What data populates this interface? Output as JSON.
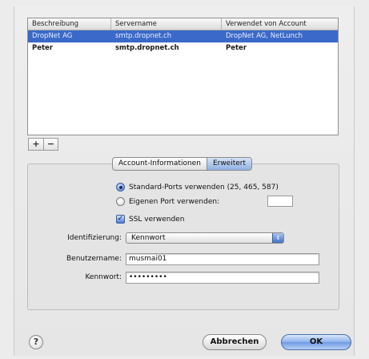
{
  "table": {
    "columns": [
      "Beschreibung",
      "Servername",
      "Verwendet von Account"
    ],
    "rows": [
      {
        "description": "DropNet AG",
        "server": "smtp.dropnet.ch",
        "used_by": "DropNet AG, NetLunch",
        "selected": true
      },
      {
        "description": "Peter",
        "server": "smtp.dropnet.ch",
        "used_by": "Peter",
        "selected": false
      }
    ]
  },
  "list_controls": {
    "add": "+",
    "remove": "−"
  },
  "tabs": [
    {
      "label": "Account-Informationen",
      "active": false
    },
    {
      "label": "Erweitert",
      "active": true
    }
  ],
  "ports": {
    "standard_label": "Standard-Ports verwenden (25, 465, 587)",
    "custom_label": "Eigenen Port verwenden:",
    "custom_value": ""
  },
  "ssl": {
    "label": "SSL verwenden",
    "checked": true,
    "check_glyph": "✓"
  },
  "auth": {
    "label": "Identifizierung:",
    "value": "Kennwort",
    "arrows": "⇕"
  },
  "username": {
    "label": "Benutzername:",
    "value": "musmai01"
  },
  "password": {
    "label": "Kennwort:",
    "value": "•••••••••"
  },
  "footer": {
    "help": "?",
    "cancel": "Abbrechen",
    "ok": "OK"
  },
  "colors": {
    "selection": "#3b69c9",
    "accent": "#6f9be3"
  }
}
